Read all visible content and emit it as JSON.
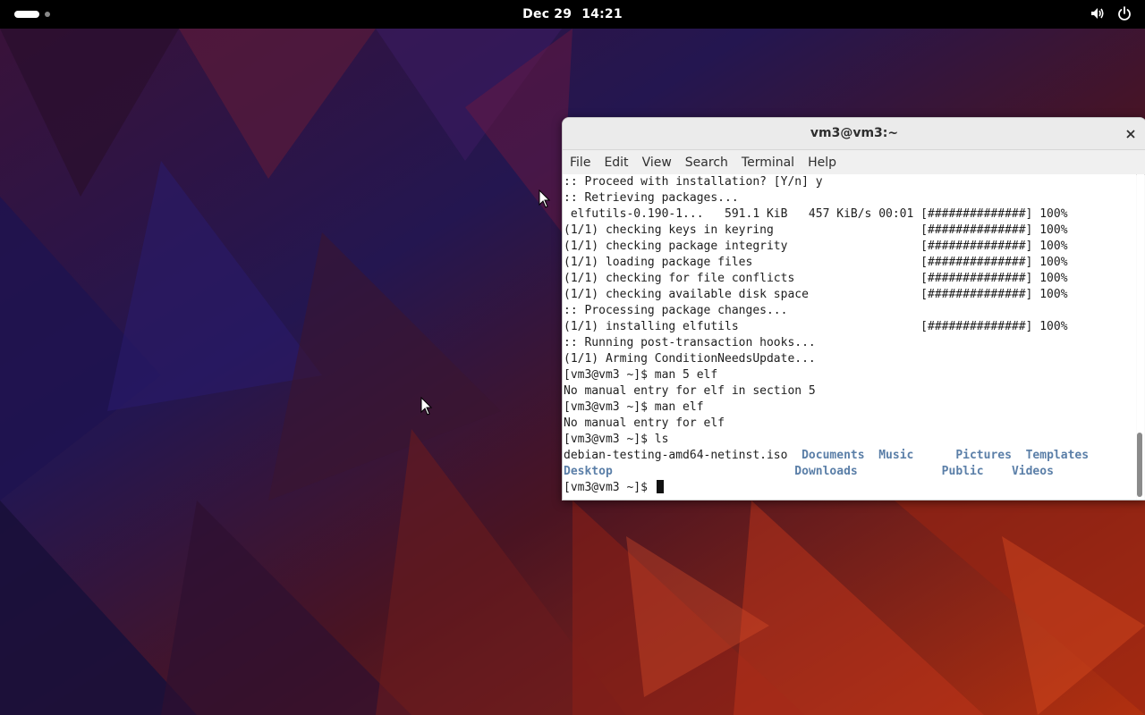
{
  "topbar": {
    "date": "Dec 29",
    "time": "14:21",
    "icons": [
      "volume-icon",
      "power-icon"
    ]
  },
  "window": {
    "title": "vm3@vm3:~",
    "menu": [
      "File",
      "Edit",
      "View",
      "Search",
      "Terminal",
      "Help"
    ]
  },
  "terminal": {
    "lines": [
      ":: Proceed with installation? [Y/n] y",
      ":: Retrieving packages...",
      " elfutils-0.190-1...   591.1 KiB   457 KiB/s 00:01 [##############] 100%",
      "(1/1) checking keys in keyring                     [##############] 100%",
      "(1/1) checking package integrity                   [##############] 100%",
      "(1/1) loading package files                        [##############] 100%",
      "(1/1) checking for file conflicts                  [##############] 100%",
      "(1/1) checking available disk space                [##############] 100%",
      ":: Processing package changes...",
      "(1/1) installing elfutils                          [##############] 100%",
      ":: Running post-transaction hooks...",
      "(1/1) Arming ConditionNeedsUpdate...",
      "[vm3@vm3 ~]$ man 5 elf",
      "No manual entry for elf in section 5",
      "[vm3@vm3 ~]$ man elf",
      "No manual entry for elf",
      "[vm3@vm3 ~]$ ls"
    ],
    "ls_row1": {
      "iso": "debian-testing-amd64-netinst.iso",
      "documents": "Documents",
      "music": "Music",
      "pictures": "Pictures",
      "templates": "Templates"
    },
    "ls_row2": {
      "desktop": "Desktop",
      "downloads": "Downloads",
      "public": "Public",
      "videos": "Videos"
    },
    "prompt": "[vm3@vm3 ~]$ "
  },
  "colors": {
    "dir_blue": "#5b7fa8",
    "topbar": "#000000"
  }
}
